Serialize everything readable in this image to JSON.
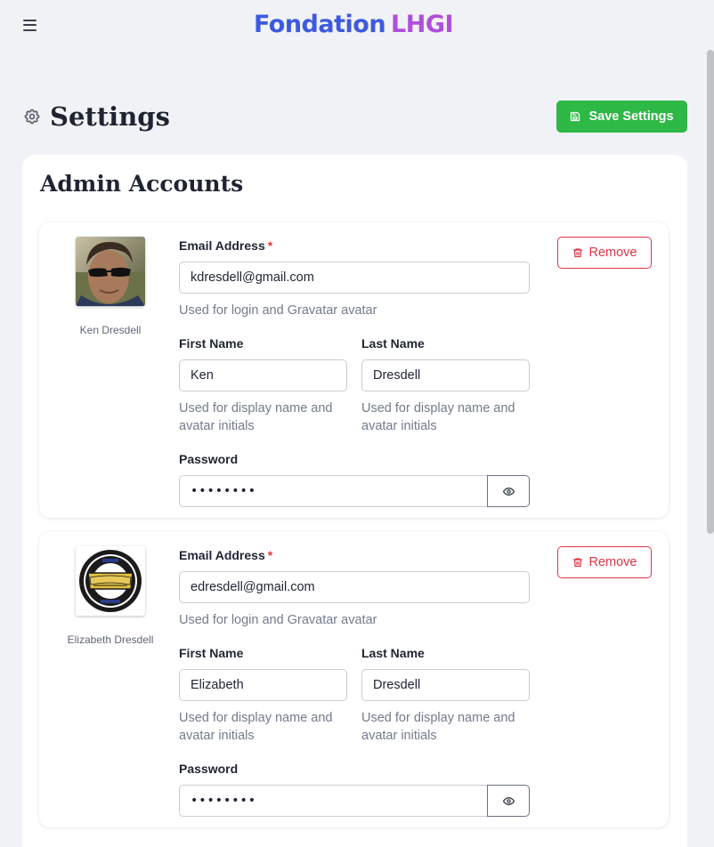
{
  "app": {
    "brand_part1": "Fondation",
    "brand_part2": "LHGI",
    "brand_colors": {
      "part1": "#3d5adf",
      "part2": "#b04fdb"
    },
    "menu_icon": "hamburger-menu-icon"
  },
  "page": {
    "title": "Settings",
    "title_icon": "gear-icon",
    "save_label": "Save Settings",
    "save_icon": "floppy-disk-icon",
    "accent_color": "#2eb845"
  },
  "admin": {
    "section_title": "Admin Accounts",
    "accounts": [
      {
        "display_name": "Ken Dresdell",
        "email_label": "Email Address",
        "required_mark": "*",
        "email": "kdresdell@gmail.com",
        "email_hint": "Used for login and Gravatar avatar",
        "first_name_label": "First Name",
        "first_name": "Ken",
        "first_name_hint": "Used for display name and avatar initials",
        "last_name_label": "Last Name",
        "last_name": "Dresdell",
        "last_name_hint": "Used for display name and avatar initials",
        "password_label": "Password",
        "password_masked": "••••••••",
        "remove_label": "Remove"
      },
      {
        "display_name": "Elizabeth Dresdell",
        "email_label": "Email Address",
        "required_mark": "*",
        "email": "edresdell@gmail.com",
        "email_hint": "Used for login and Gravatar avatar",
        "first_name_label": "First Name",
        "first_name": "Elizabeth",
        "first_name_hint": "Used for display name and avatar initials",
        "last_name_label": "Last Name",
        "last_name": "Dresdell",
        "last_name_hint": "Used for display name and avatar initials",
        "password_label": "Password",
        "password_masked": "••••••••",
        "remove_label": "Remove"
      }
    ]
  },
  "logo_text": {
    "top": "LIGUE de HOCKEY",
    "center": "Fondation",
    "bottom": "GAGNON IMAGE"
  }
}
